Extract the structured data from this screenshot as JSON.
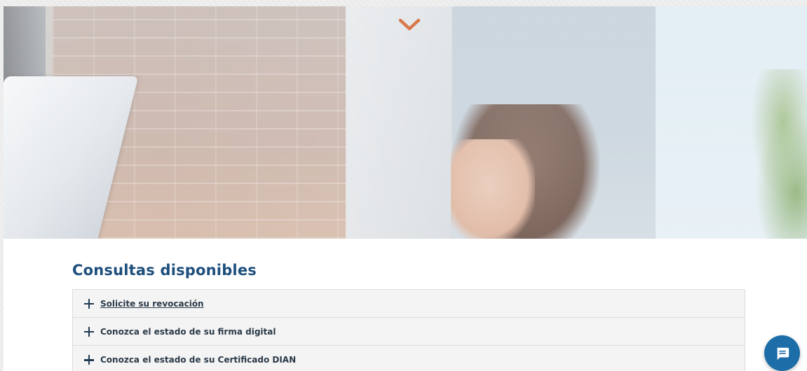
{
  "hero": {
    "scroll_icon": "chevron-down-icon",
    "accent_color": "#d9784a"
  },
  "main": {
    "section_title": "Consultas disponibles",
    "accordion": [
      {
        "label": "Solicite su revocación",
        "icon": "plus-icon"
      },
      {
        "label": "Conozca el estado de su firma digital",
        "icon": "plus-icon"
      },
      {
        "label": "Conozca el estado de su Certificado DIAN",
        "icon": "plus-icon"
      }
    ]
  },
  "chat": {
    "icon": "chat-icon",
    "color": "#1d6ea8"
  }
}
